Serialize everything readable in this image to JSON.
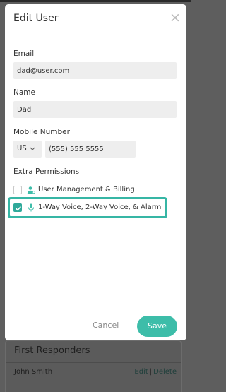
{
  "modal": {
    "title": "Edit User",
    "close_glyph": "×",
    "fields": {
      "email_label": "Email",
      "email_value": "dad@user.com",
      "name_label": "Name",
      "name_value": "Dad",
      "mobile_label": "Mobile Number",
      "country_code": "US",
      "phone_value": "(555) 555 5555"
    },
    "permissions": {
      "heading": "Extra Permissions",
      "items": [
        {
          "label": "User Management & Billing",
          "checked": false,
          "icon": "user-gear-icon"
        },
        {
          "label": "1-Way Voice, 2-Way Voice, & Alarm",
          "checked": true,
          "icon": "microphone-icon"
        }
      ]
    },
    "actions": {
      "cancel_label": "Cancel",
      "save_label": "Save"
    }
  },
  "background": {
    "card_title": "First Responders",
    "row": {
      "name": "John Smith",
      "edit_label": "Edit",
      "separator": "|",
      "delete_label": "Delete"
    }
  },
  "colors": {
    "accent": "#3dbda9",
    "highlight_border": "#36b6a5",
    "overlay": "#5e5e5e"
  }
}
